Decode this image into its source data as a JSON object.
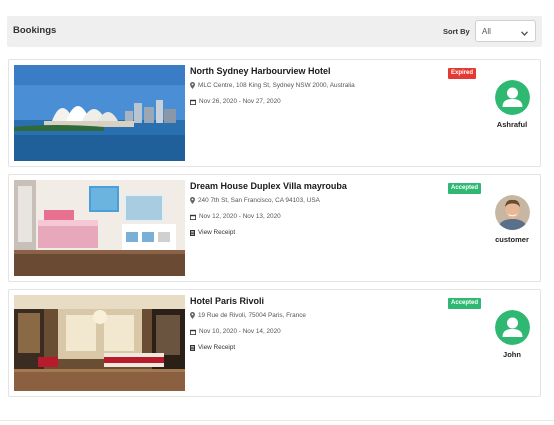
{
  "header": {
    "title": "Bookings",
    "sort_label": "Sort By",
    "sort_value": "All"
  },
  "bookings": [
    {
      "title": "North Sydney Harbourview Hotel",
      "address": "MLC Centre, 108 King St, Sydney NSW 2000, Australia",
      "dates": "Nov 26, 2020 - Nov 27, 2020",
      "status": "Expired",
      "status_color": "#e53935",
      "user": "Ashraful",
      "avatar_type": "default-user-icon"
    },
    {
      "title": "Dream House Duplex Villa mayrouba",
      "address": "240 7th St, San Francisco, CA 94103, USA",
      "dates": "Nov 12, 2020 - Nov 13, 2020",
      "receipt": "View Receipt",
      "status": "Accepted",
      "status_color": "#2eb872",
      "user": "customer",
      "avatar_type": "photo"
    },
    {
      "title": "Hotel Paris Rivoli",
      "address": "19 Rue de Rivoli, 75004 Paris, France",
      "dates": "Nov 10, 2020 - Nov 14, 2020",
      "receipt": "View Receipt",
      "status": "Accepted",
      "status_color": "#2eb872",
      "user": "John",
      "avatar_type": "default-user-icon"
    }
  ],
  "colors": {
    "avatar_green": "#2eb872",
    "header_bg": "#efefef"
  }
}
